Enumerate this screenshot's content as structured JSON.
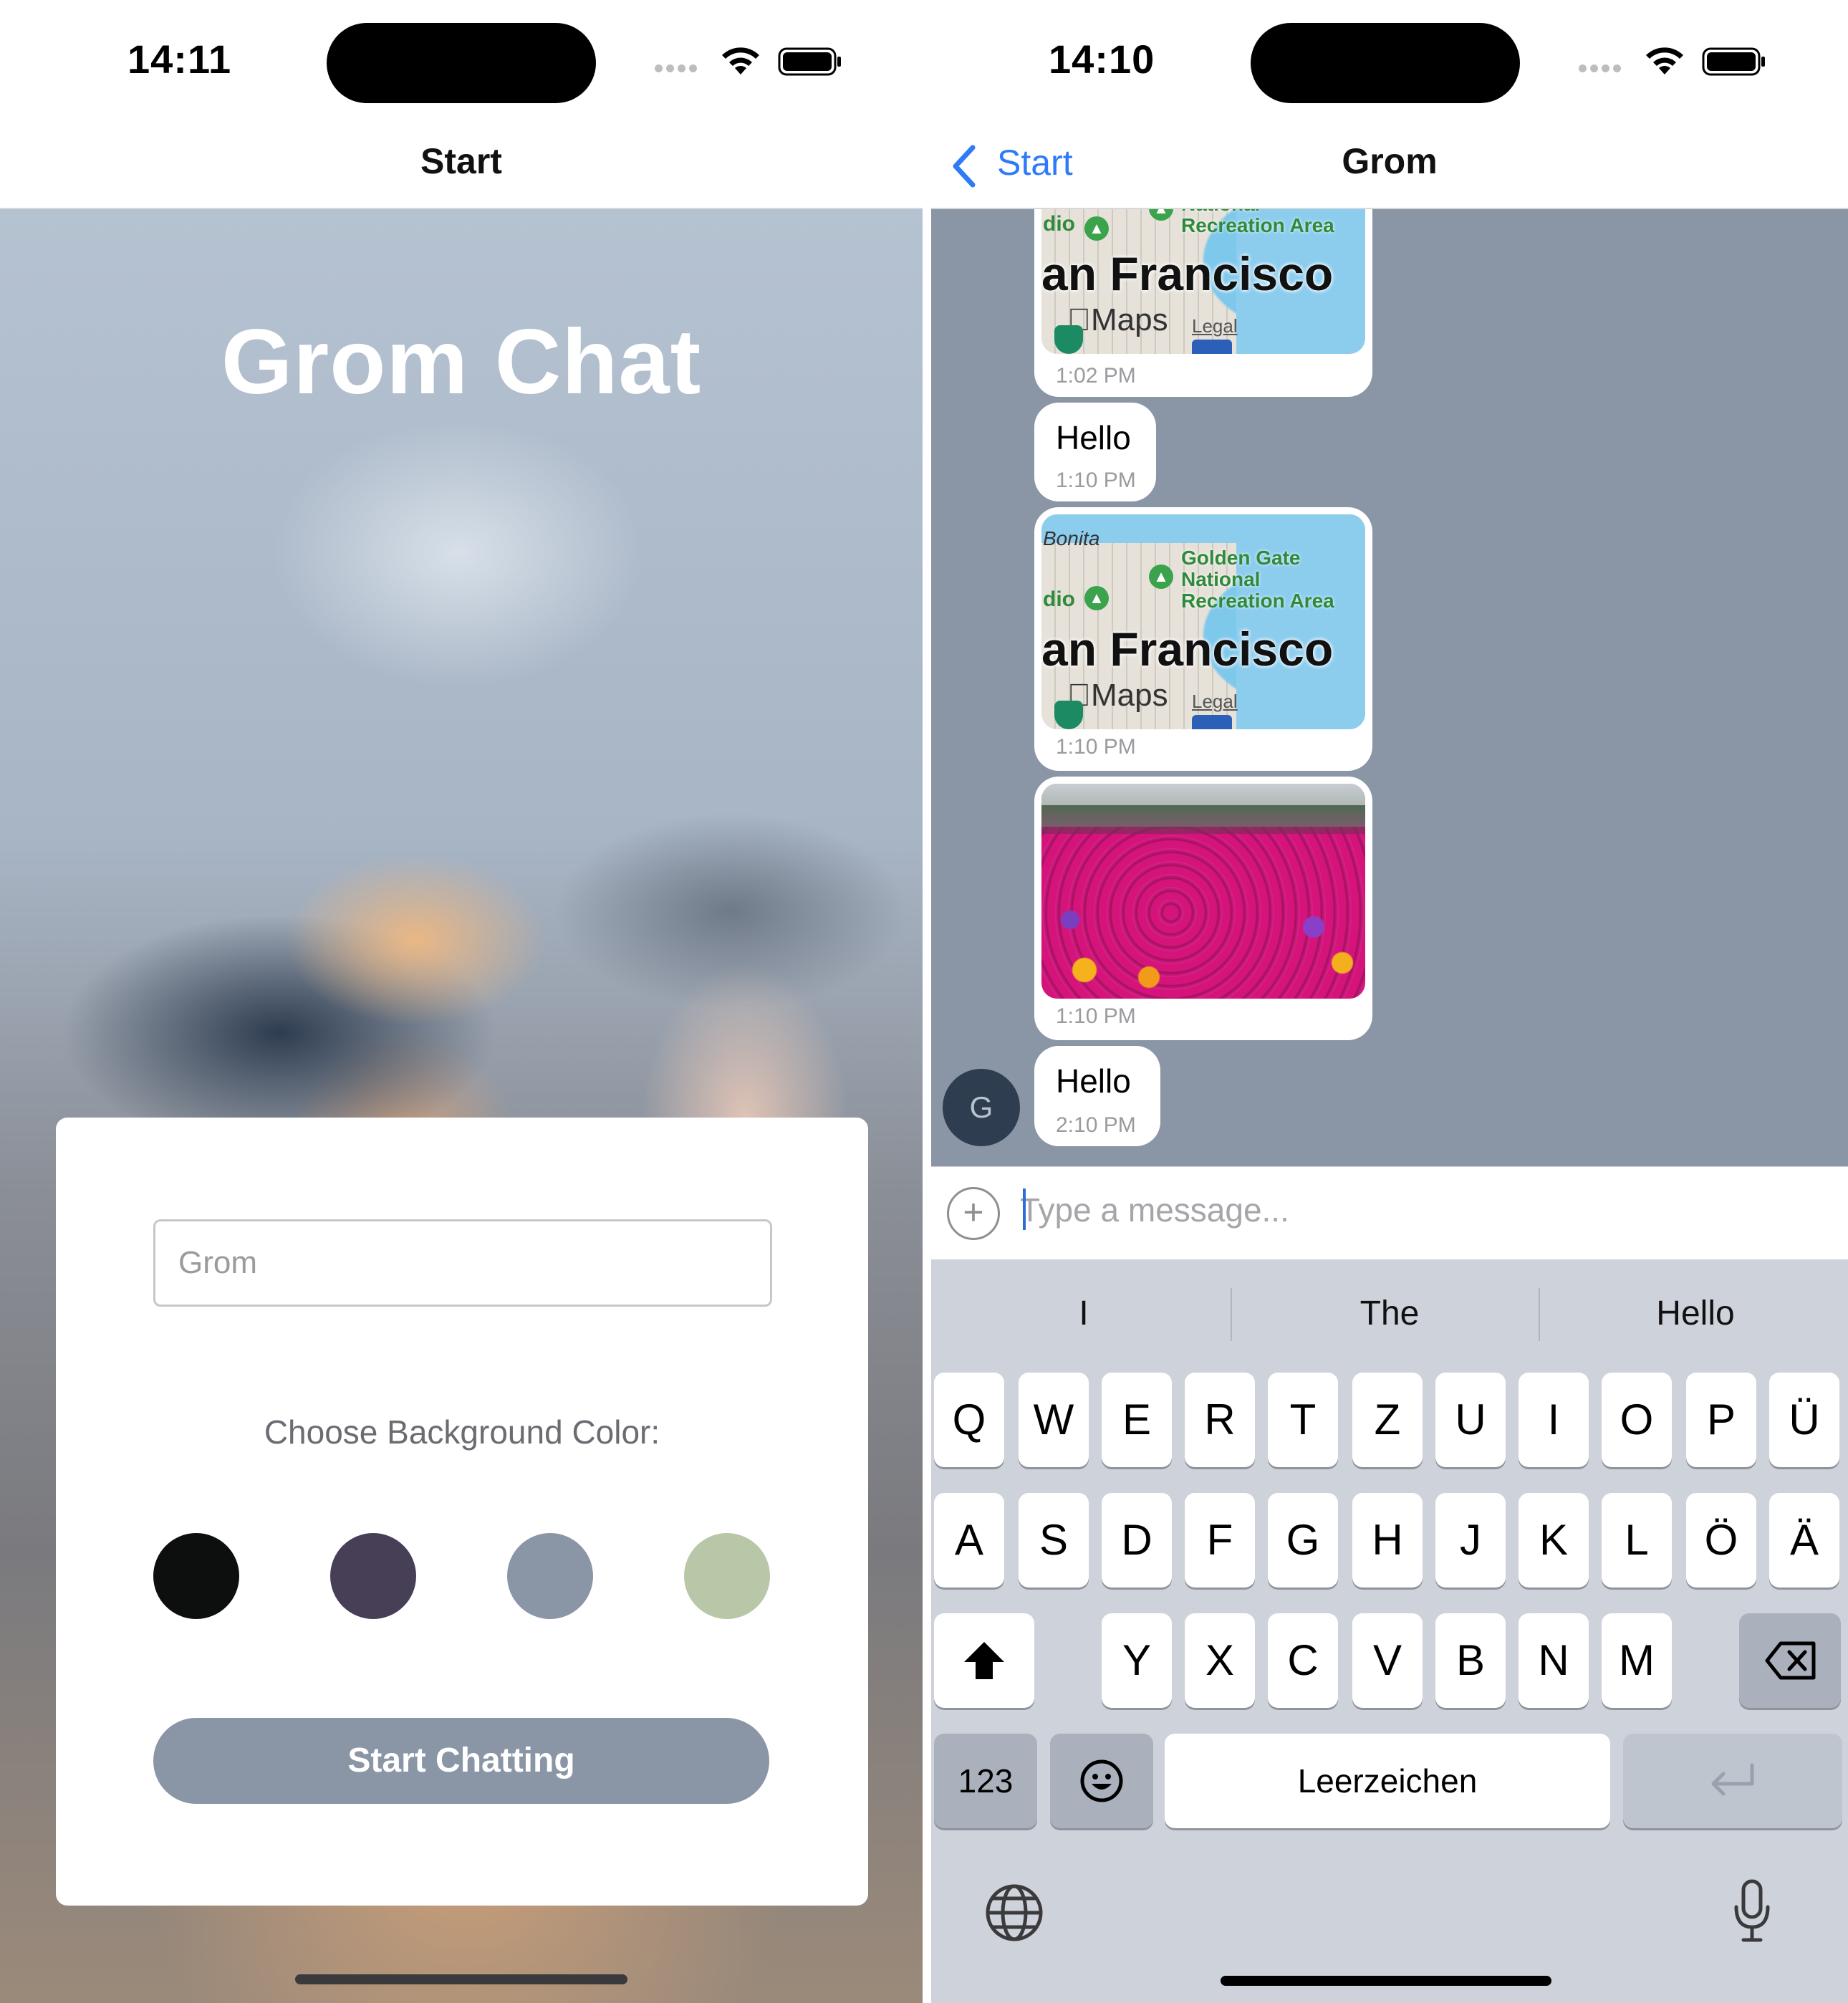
{
  "left": {
    "status": {
      "time": "14:11"
    },
    "nav": {
      "title": "Start"
    },
    "app_title": "Grom Chat",
    "form": {
      "name_value": "",
      "name_placeholder": "Grom",
      "choose_label": "Choose Background Color:",
      "swatches": [
        "#0c0f0d",
        "#473f56",
        "#8a95a6",
        "#b8c7a8"
      ],
      "start_button": "Start Chatting"
    }
  },
  "right": {
    "status": {
      "time": "14:10"
    },
    "nav": {
      "back_label": "Start",
      "title": "Grom"
    },
    "chat_background": "#8a95a6",
    "map_labels": {
      "bonita": "Bonita",
      "park": [
        "Golden Gate",
        "National",
        "Recreation Area"
      ],
      "park_short": "Recreation Area",
      "presidio": "dio",
      "city": "an Francisco",
      "maps": "Maps",
      "legal": "Legal"
    },
    "messages": [
      {
        "type": "location",
        "time": "1:02 PM"
      },
      {
        "type": "text",
        "text": "Hello",
        "time": "1:10 PM"
      },
      {
        "type": "location",
        "time": "1:10 PM"
      },
      {
        "type": "image",
        "time": "1:10 PM"
      },
      {
        "type": "text",
        "text": "Hello",
        "time": "2:10 PM"
      }
    ],
    "avatar_initial": "G",
    "composer": {
      "placeholder": "Type a message...",
      "value": ""
    },
    "keyboard": {
      "suggestions": [
        "I",
        "The",
        "Hello"
      ],
      "row1": [
        "Q",
        "W",
        "E",
        "R",
        "T",
        "Z",
        "U",
        "I",
        "O",
        "P",
        "Ü"
      ],
      "row2": [
        "A",
        "S",
        "D",
        "F",
        "G",
        "H",
        "J",
        "K",
        "L",
        "Ö",
        "Ä"
      ],
      "row3": [
        "Y",
        "X",
        "C",
        "V",
        "B",
        "N",
        "M"
      ],
      "numbers_key": "123",
      "space_key": "Leerzeichen"
    }
  }
}
